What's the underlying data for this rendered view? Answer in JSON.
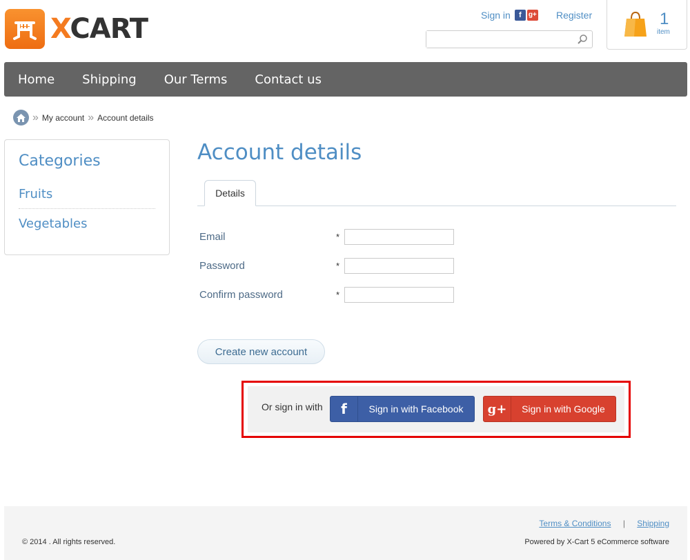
{
  "brand": {
    "logo_part1": "X",
    "logo_part2": "CART",
    "accent": "#f47b20"
  },
  "header": {
    "sign_in": "Sign in",
    "register": "Register",
    "search_placeholder": "",
    "cart_count": "1",
    "cart_item_label": "item"
  },
  "nav": {
    "items": [
      "Home",
      "Shipping",
      "Our Terms",
      "Contact us"
    ]
  },
  "breadcrumb": {
    "items": [
      "My account",
      "Account details"
    ]
  },
  "sidebar": {
    "title": "Categories",
    "items": [
      "Fruits",
      "Vegetables"
    ]
  },
  "main": {
    "title": "Account details",
    "tab": "Details",
    "fields": [
      {
        "label": "Email",
        "required": "*",
        "value": ""
      },
      {
        "label": "Password",
        "required": "*",
        "value": ""
      },
      {
        "label": "Confirm password",
        "required": "*",
        "value": ""
      }
    ],
    "create_button": "Create new account"
  },
  "social": {
    "or_text": "Or sign in with",
    "facebook_label": "Sign in with Facebook",
    "google_label": "Sign in with Google",
    "facebook_color": "#3d5fa6",
    "google_color": "#d8412f"
  },
  "footer": {
    "links": [
      "Terms & Conditions",
      "Shipping"
    ],
    "copyright": "© 2014 . All rights reserved.",
    "powered": "Powered by X-Cart 5 eCommerce software"
  }
}
